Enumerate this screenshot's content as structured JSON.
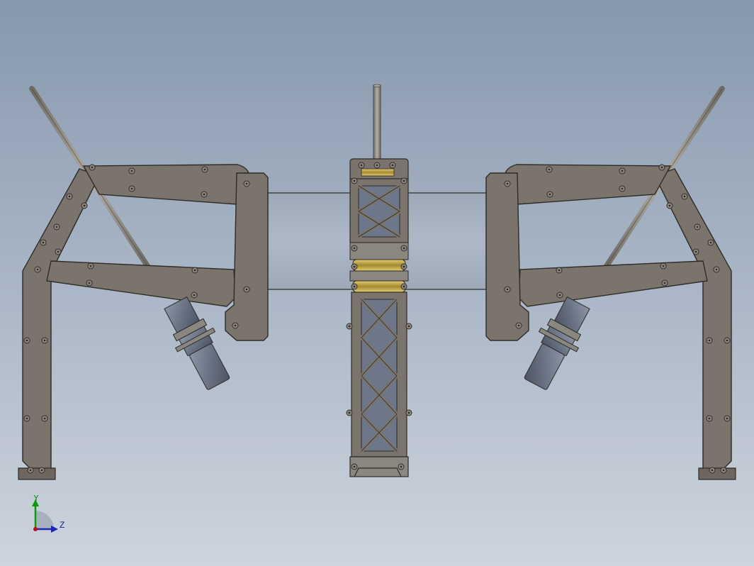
{
  "viewport": {
    "background_top": "#8798ad",
    "background_bottom": "#cdd4dd"
  },
  "model": {
    "plate_color": "#7a746c",
    "plate_edge": "#2e2b28",
    "rod_color": "#948e86",
    "motor_color": "#6f7888",
    "bushing_color": "#b8a14a"
  },
  "triad": {
    "y_label": "Y",
    "z_label": "Z",
    "y_color": "#0a9a0a",
    "z_color": "#1a2ab0",
    "x_color": "#c01010"
  }
}
